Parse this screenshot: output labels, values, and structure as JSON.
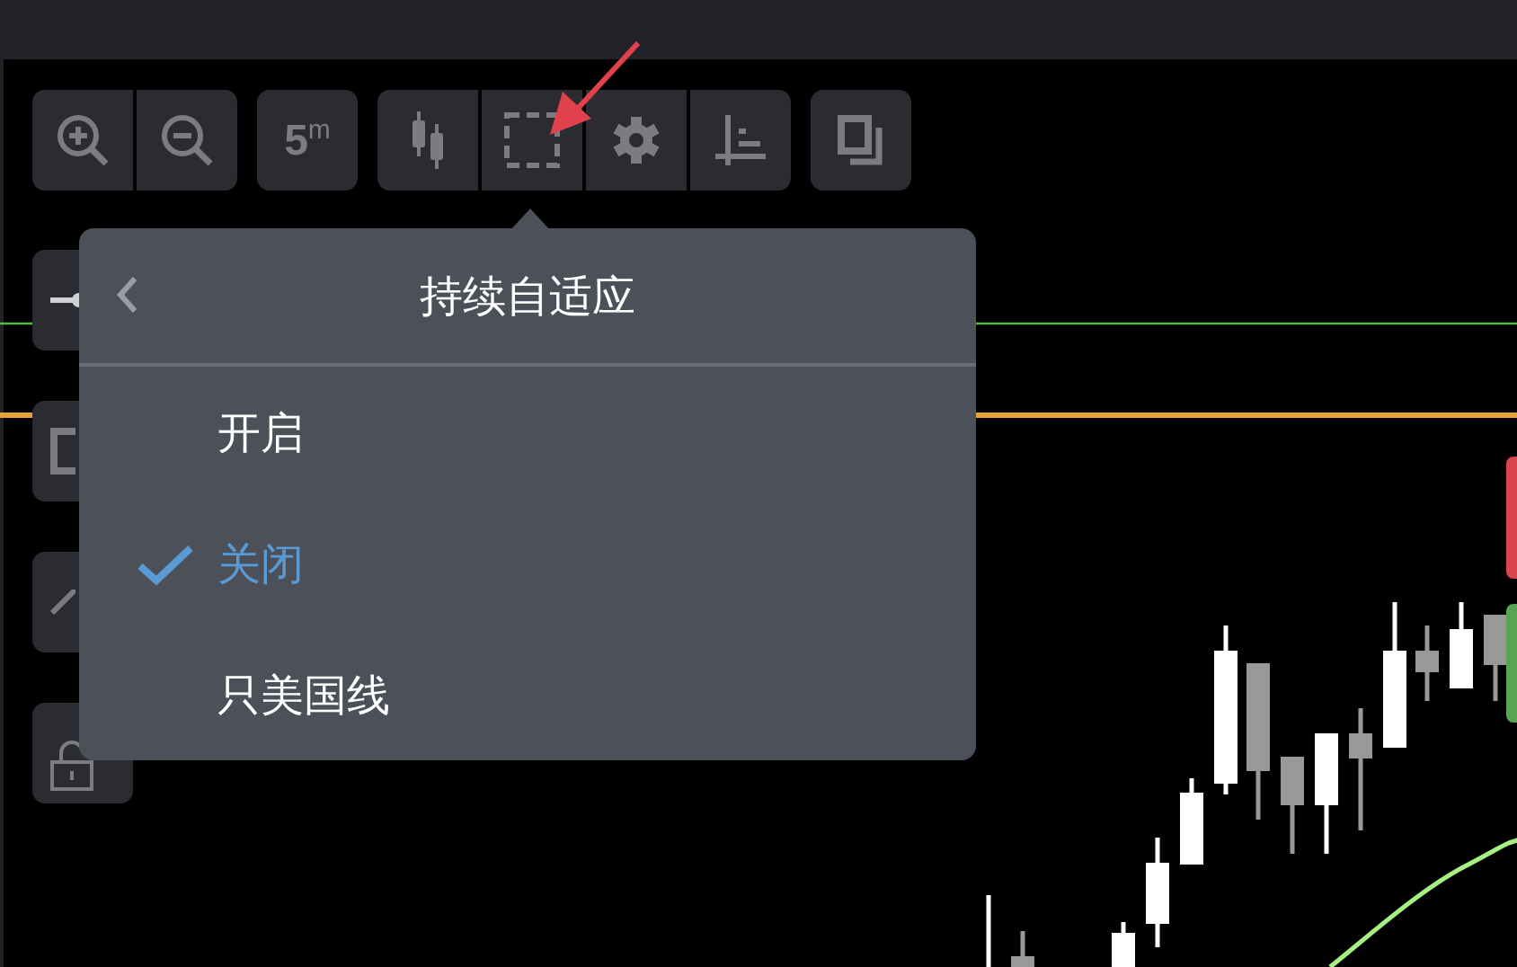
{
  "toolbar": {
    "groups": [
      [
        {
          "kind": "zoom_in"
        },
        {
          "kind": "zoom_out"
        }
      ],
      [
        {
          "kind": "text",
          "label": "5$^{m}$"
        }
      ],
      [
        {
          "kind": "candles"
        },
        {
          "kind": "select_box"
        },
        {
          "kind": "gear"
        },
        {
          "kind": "axis"
        }
      ],
      [
        {
          "kind": "copy"
        }
      ]
    ]
  },
  "side_tools": [
    {
      "kind": "node"
    },
    {
      "kind": "box"
    },
    {
      "kind": "line"
    },
    {
      "kind": "lock"
    }
  ],
  "menu": {
    "title": "持续自适应",
    "items": [
      {
        "label": "开启",
        "selected": false
      },
      {
        "label": "关闭",
        "selected": true
      },
      {
        "label": "只美国线",
        "selected": false
      }
    ]
  }
}
